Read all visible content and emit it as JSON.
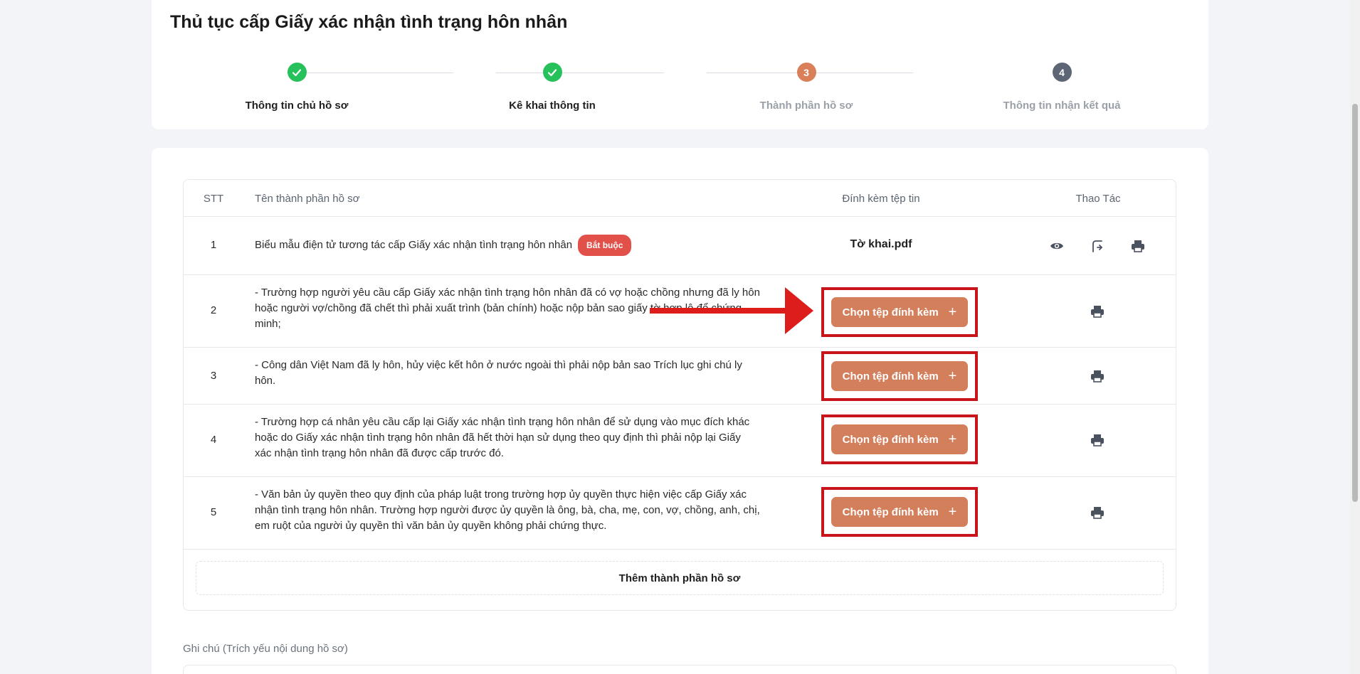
{
  "page_title": "Thủ tục cấp Giấy xác nhận tình trạng hôn nhân",
  "steps": [
    {
      "number": "1",
      "label": "Thông tin chủ hồ sơ",
      "status": "done"
    },
    {
      "number": "2",
      "label": "Kê khai thông tin",
      "status": "done"
    },
    {
      "number": "3",
      "label": "Thành phần hồ sơ",
      "status": "active"
    },
    {
      "number": "4",
      "label": "Thông tin nhận kết quả",
      "status": "todo"
    }
  ],
  "table": {
    "headers": {
      "stt": "STT",
      "name": "Tên thành phần hồ sơ",
      "attach": "Đính kèm tệp tin",
      "actions": "Thao Tác"
    },
    "rows": [
      {
        "stt": "1",
        "name": "Biểu mẫu điện tử tương tác cấp Giấy xác nhận tình trạng hôn nhân",
        "badge": "Bắt buộc",
        "file": "Tờ khai.pdf"
      },
      {
        "stt": "2",
        "name": "- Trường hợp người yêu cầu cấp Giấy xác nhận tình trạng hôn nhân đã có vợ hoặc chồng nhưng đã ly hôn hoặc người vợ/chồng đã chết thì phải xuất trình (bản chính) hoặc nộp bản sao giấy tờ hợp lệ để chứng minh;",
        "button": "Chọn tệp đính kèm"
      },
      {
        "stt": "3",
        "name": "- Công dân Việt Nam đã ly hôn, hủy việc kết hôn ở nước ngoài thì phải nộp bản sao Trích lục ghi chú ly hôn.",
        "button": "Chọn tệp đính kèm"
      },
      {
        "stt": "4",
        "name": "- Trường hợp cá nhân yêu cầu cấp lại Giấy xác nhận tình trạng hôn nhân để sử dụng vào mục đích khác hoặc do Giấy xác nhận tình trạng hôn nhân đã hết thời hạn sử dụng theo quy định thì phải nộp lại Giấy xác nhận tình trạng hôn nhân đã được cấp trước đó.",
        "button": "Chọn tệp đính kèm"
      },
      {
        "stt": "5",
        "name": "- Văn bản ủy quyền theo quy định của pháp luật trong trường hợp ủy quyền thực hiện việc cấp Giấy xác nhận tình trạng hôn nhân. Trường hợp người được ủy quyền là ông, bà, cha, mẹ, con, vợ, chồng, anh, chị, em ruột của người ủy quyền thì văn bản ủy quyền không phải chứng thực.",
        "button": "Chọn tệp đính kèm"
      }
    ],
    "add_row_label": "Thêm thành phần hồ sơ"
  },
  "note_label": "Ghi chú (Trích yếu nội dung hồ sơ)",
  "icons": {
    "step_done": "check-icon",
    "view": "eye-icon",
    "sign": "signature-icon",
    "print": "printer-icon",
    "add": "plus-icon",
    "annotation": "red-arrow"
  },
  "colors": {
    "primary_button": "#d37f5c",
    "step_done": "#27c15c",
    "step_active": "#d9805b",
    "step_todo": "#5c6675",
    "badge": "#e2504a",
    "highlight": "#c8151b"
  }
}
